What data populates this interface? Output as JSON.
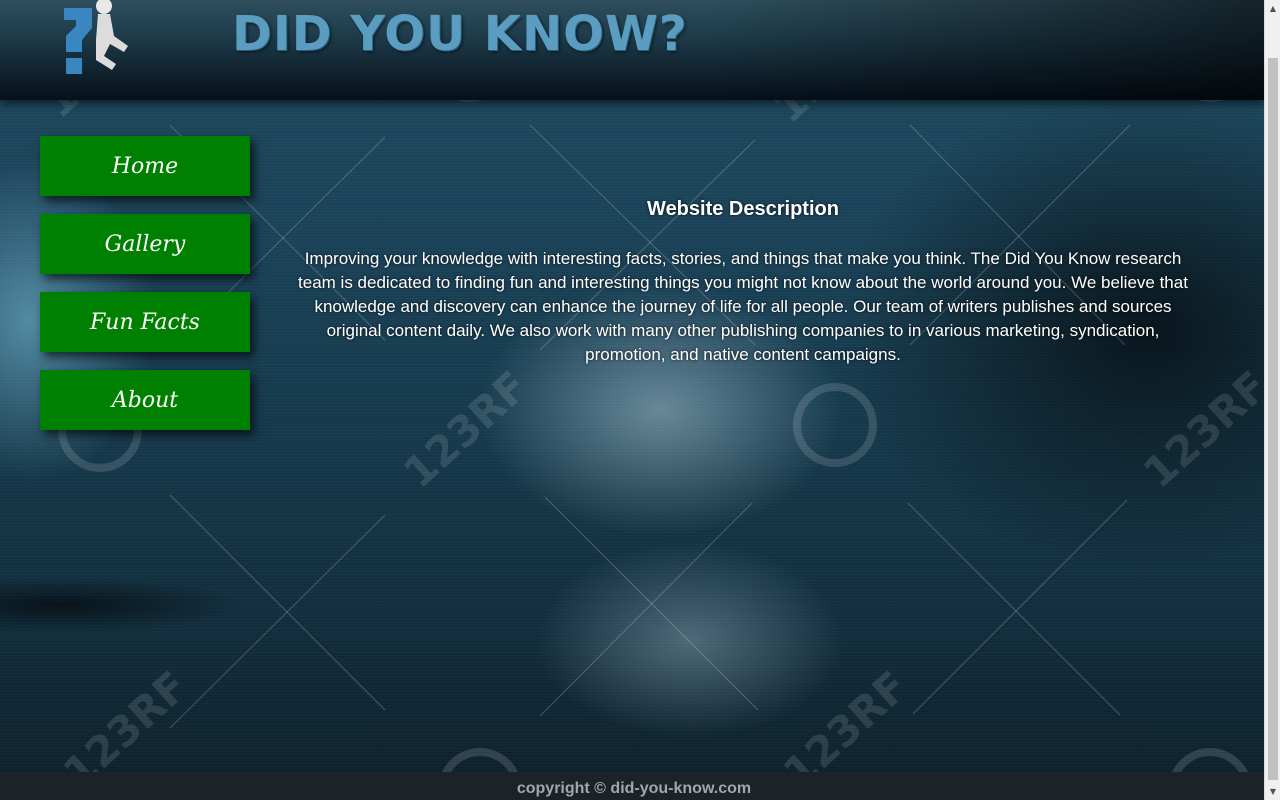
{
  "header": {
    "title": "DID YOU KNOW?",
    "logo_icon": "question-mark-figure-icon"
  },
  "nav": {
    "items": [
      {
        "label": "Home"
      },
      {
        "label": "Gallery"
      },
      {
        "label": "Fun Facts"
      },
      {
        "label": "About"
      }
    ]
  },
  "main": {
    "title": "Website Description",
    "description": "Improving your knowledge with interesting facts, stories, and things that make you think. The Did You Know research team is dedicated to finding fun and interesting things you might not know about the world around you. We believe that knowledge and discovery can enhance the journey of life for all people. Our team of writers publishes and sources original content daily. We also work with many other publishing companies to in various marketing, syndication, promotion, and native content campaigns."
  },
  "footer": {
    "symbol": "©",
    "text": "copyright © did-you-know.com"
  },
  "watermark": {
    "text": "123RF"
  },
  "colors": {
    "nav_button": "#008000",
    "title": "#5a9dc0",
    "footer_bg": "#1c2328"
  }
}
